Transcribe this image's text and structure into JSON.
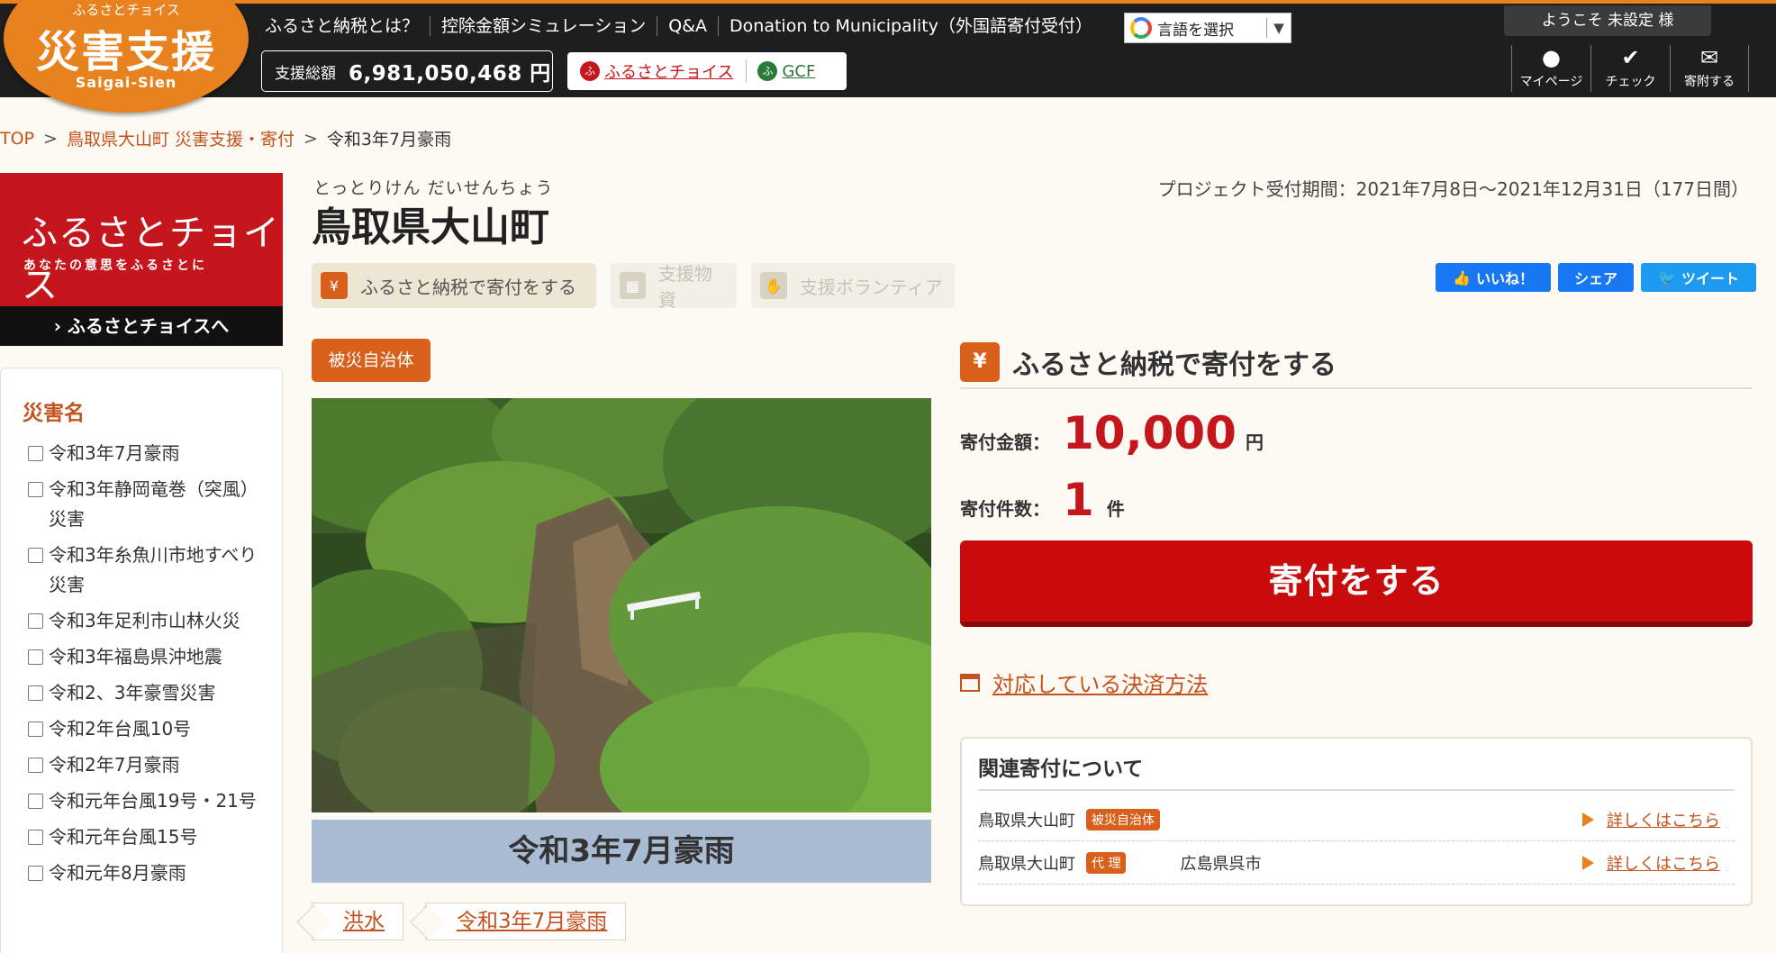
{
  "header": {
    "logo": {
      "small": "ふるさとチョイス",
      "main": "災害支援",
      "roman": "Saigai-Sien"
    },
    "nav": [
      "ふるさと納税とは？",
      "控除金額シミュレーション",
      "Q&A",
      "Donation to Municipality（外国語寄付受付）"
    ],
    "language_select": "言語を選択",
    "total_label": "支援総額",
    "total_value": "6,981,050,468 円",
    "partner_fc": "ふるさとチョイス",
    "partner_gcf": "GCF",
    "welcome": "ようこそ 未設定 様",
    "user_icons": [
      {
        "label": "マイページ",
        "icon": "user-icon"
      },
      {
        "label": "チェック",
        "icon": "check-icon"
      },
      {
        "label": "寄附する",
        "icon": "donate-icon"
      }
    ]
  },
  "breadcrumb": {
    "top": "TOP",
    "parent": "鳥取県大山町 災害支援・寄付",
    "current": "令和3年7月豪雨"
  },
  "sidebar": {
    "banner_title": "ふるさとチョイス",
    "banner_sub": "あなたの意思をふるさとに",
    "banner_link": "› ふるさとチョイスへ",
    "disaster_heading": "災害名",
    "disasters": [
      "令和3年7月豪雨",
      "令和3年静岡竜巻（突風）災害",
      "令和3年糸魚川市地すべり災害",
      "令和3年足利市山林火災",
      "令和3年福島県沖地震",
      "令和2、3年豪雪災害",
      "令和2年台風10号",
      "令和2年7月豪雨",
      "令和元年台風19号・21号",
      "令和元年台風15号",
      "令和元年8月豪雨"
    ]
  },
  "project": {
    "kana": "とっとりけん だいせんちょう",
    "title": "鳥取県大山町",
    "period": "プロジェクト受付期間：2021年7月8日～2021年12月31日（177日間）",
    "tabs": [
      "ふるさと納税で寄付をする",
      "支援物資",
      "支援ボランティア"
    ],
    "social": [
      "いいね！",
      "シェア",
      "ツイート"
    ],
    "badge": "被災自治体",
    "photo_caption": "令和3年7月豪雨",
    "tags": [
      "洪水",
      "令和3年7月豪雨"
    ]
  },
  "donation": {
    "heading": "ふるさと納税で寄付をする",
    "amount_label": "寄付金額：",
    "amount_value": "10,000",
    "amount_unit": "円",
    "count_label": "寄付件数：",
    "count_value": "1",
    "count_unit": "件",
    "button": "寄付をする",
    "payment_link": "対応している決済方法"
  },
  "related": {
    "heading": "関連寄付について",
    "rows": [
      {
        "name": "鳥取県大山町",
        "badge": "被災自治体",
        "partner": "",
        "link": "詳しくはこちら"
      },
      {
        "name": "鳥取県大山町",
        "badge": "代 理",
        "partner": "広島県呉市",
        "link": "詳しくはこちら"
      }
    ]
  },
  "colors": {
    "accent_orange": "#e8821e",
    "brand_red": "#c4161c",
    "donate_red": "#c80c0c",
    "header_bg": "#1e1e1e",
    "caption_blue": "#a9bcd4"
  }
}
